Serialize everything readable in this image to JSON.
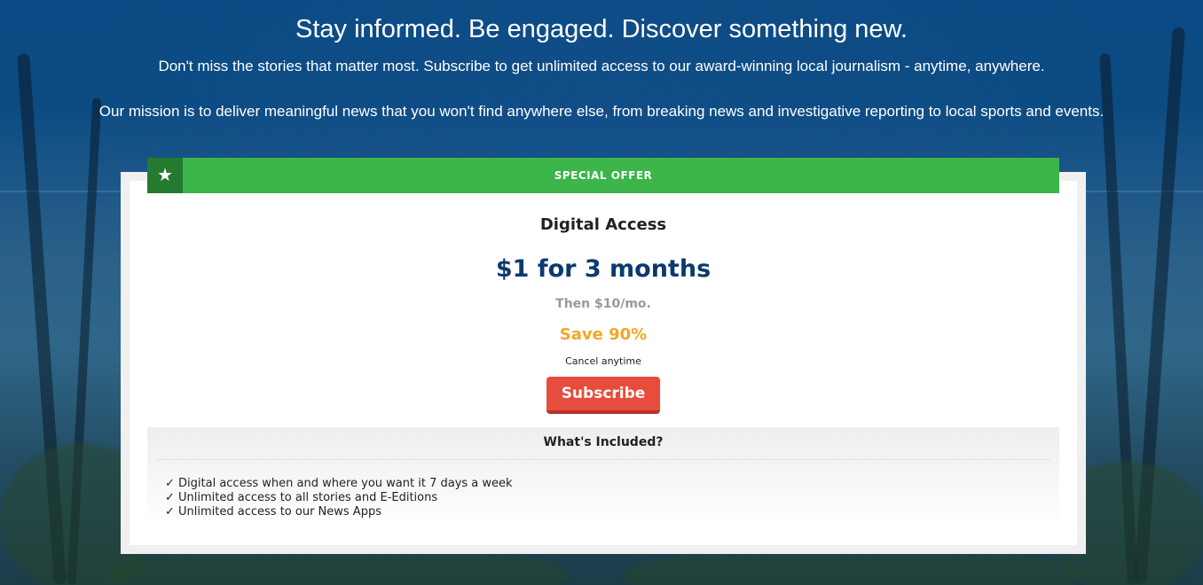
{
  "hero": {
    "headline": "Stay informed. Be engaged. Discover something new.",
    "subhead": "Don't miss the stories that matter most. Subscribe to get unlimited access to our award-winning local journalism - anytime, anywhere.",
    "mission": "Our mission is to deliver meaningful news that you won't find anywhere else, from breaking news and investigative reporting to local sports and events."
  },
  "offer": {
    "banner_icon": "star-icon",
    "banner_label": "SPECIAL OFFER",
    "plan_name": "Digital Access",
    "price": "$1 for 3 months",
    "then_price": "Then $10/mo.",
    "savings": "Save 90%",
    "cancel_note": "Cancel anytime",
    "subscribe_label": "Subscribe"
  },
  "included": {
    "title": "What's Included?",
    "items": [
      "✓ Digital access when and where you want it 7 days a week",
      "✓ Unlimited access to all stories and E-Editions",
      "✓ Unlimited access to our News Apps"
    ]
  },
  "colors": {
    "banner_green": "#3cb54a",
    "banner_star_green": "#257a30",
    "price_navy": "#0d3a6e",
    "savings_orange": "#f5a623",
    "button_red": "#e74c3c"
  }
}
